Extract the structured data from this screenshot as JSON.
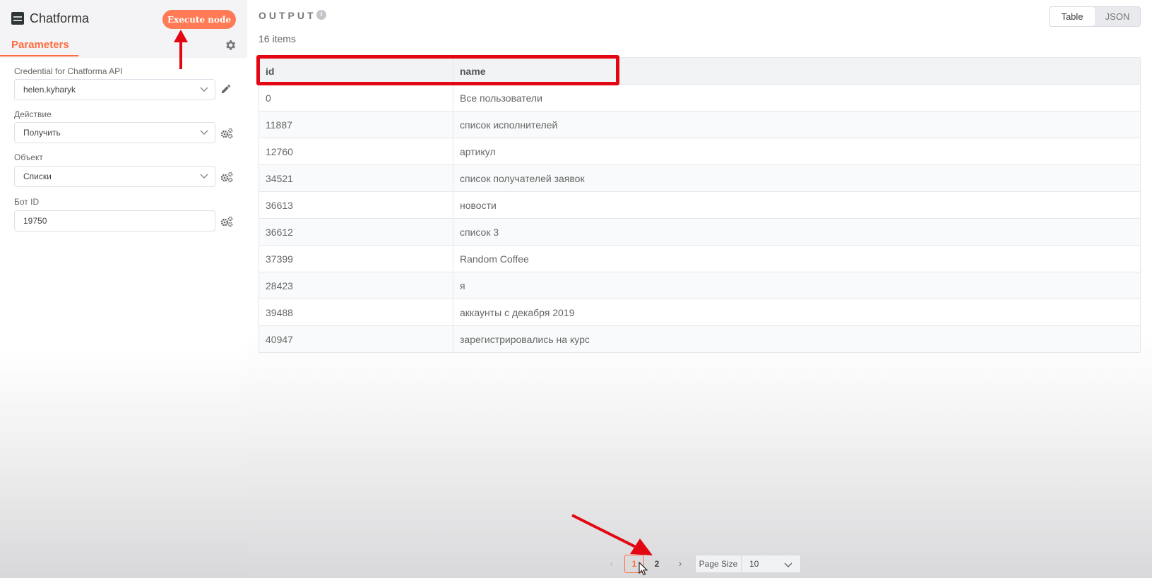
{
  "node": {
    "title": "Chatforma",
    "execute_label": "Execute node",
    "tab_label": "Parameters"
  },
  "fields": {
    "credential": {
      "label": "Credential for Chatforma API",
      "value": "helen.kyharyk"
    },
    "action": {
      "label": "Действие",
      "value": "Получить"
    },
    "object": {
      "label": "Объект",
      "value": "Списки"
    },
    "bot_id": {
      "label": "Бот ID",
      "value": "19750"
    }
  },
  "output": {
    "title": "OUTPUT",
    "info_glyph": "i",
    "count": "16 items",
    "view_table": "Table",
    "view_json": "JSON",
    "columns": [
      "id",
      "name"
    ],
    "rows": [
      [
        "0",
        "Все пользователи"
      ],
      [
        "11887",
        "список исполнителей"
      ],
      [
        "12760",
        "артикул"
      ],
      [
        "34521",
        "список получателей заявок"
      ],
      [
        "36613",
        "новости"
      ],
      [
        "36612",
        "список 3"
      ],
      [
        "37399",
        "Random Coffee"
      ],
      [
        "28423",
        "я"
      ],
      [
        "39488",
        "аккаунты с декабря 2019"
      ],
      [
        "40947",
        "зарегистрировались на курс"
      ]
    ]
  },
  "pagination": {
    "prev": "‹",
    "next": "›",
    "pages": [
      "1",
      "2"
    ],
    "current_page": "1",
    "page_size_label": "Page Size",
    "page_size_value": "10"
  },
  "colors": {
    "accent": "#ff6d3f",
    "execute_button": "#ff7a55",
    "annotation": "#e30613"
  },
  "icons": {
    "node": "chatforma-logo-icon",
    "settings": "gear-icon",
    "credential_edit": "pencil-icon",
    "field_options": "gears-icon",
    "dropdown": "chevron-down-icon",
    "info": "info-icon",
    "cursor": "mouse-cursor-icon"
  }
}
